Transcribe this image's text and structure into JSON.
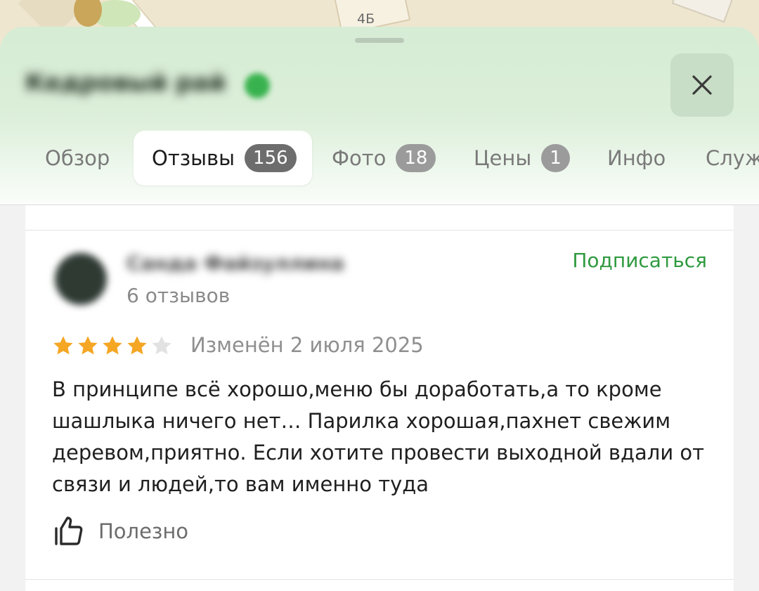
{
  "map": {
    "house_label": "4Б"
  },
  "header": {
    "place_title": "Кедровый рай",
    "close_icon": "close-icon"
  },
  "tabs": [
    {
      "label": "Обзор",
      "badge": null,
      "active": false
    },
    {
      "label": "Отзывы",
      "badge": "156",
      "active": true
    },
    {
      "label": "Фото",
      "badge": "18",
      "active": false
    },
    {
      "label": "Цены",
      "badge": "1",
      "active": false
    },
    {
      "label": "Инфо",
      "badge": null,
      "active": false
    },
    {
      "label": "Служ",
      "badge": null,
      "active": false
    }
  ],
  "review": {
    "author_name": "Санда Файзуллина",
    "author_review_count": "6 отзывов",
    "subscribe_label": "Подписаться",
    "rating": 4,
    "rating_max": 5,
    "date": "Изменён 2 июля 2025",
    "text": "В принципе всё хорошо,меню бы доработать,а то кроме шашлыка ничего нет… Парилка хорошая,пахнет свежим деревом,приятно. Если хотите провести выходной вдали от связи и людей,то вам именно туда",
    "helpful_label": "Полезно",
    "helpful_icon": "thumbs-up-icon"
  },
  "colors": {
    "accent_green": "#2f9a3f",
    "star_filled": "#f5a623",
    "star_empty": "#e2e2e2",
    "badge_active": "#6d6d6d",
    "badge_inactive": "#9b9b9b"
  }
}
